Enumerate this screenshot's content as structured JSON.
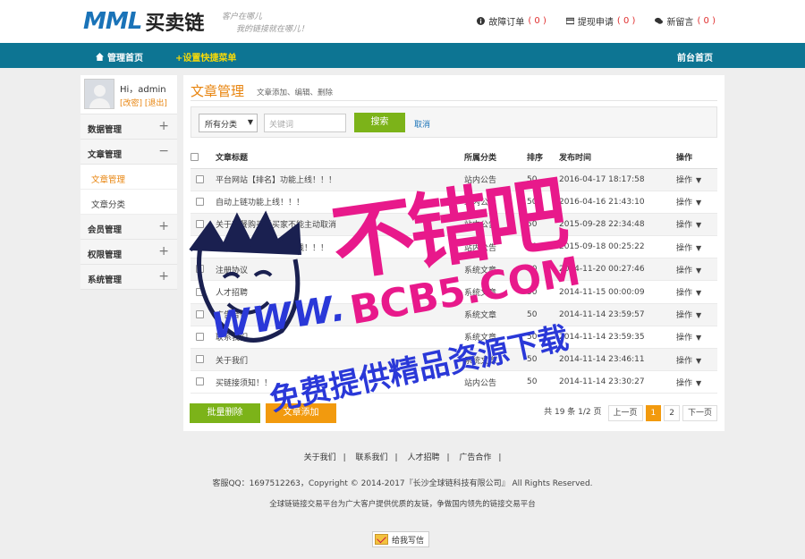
{
  "header": {
    "logo_mark": "MML",
    "logo_cn": "买卖链",
    "slogan_line1": "客户在哪儿",
    "slogan_line2": "我的链接就在哪儿！",
    "links": [
      {
        "label": "故障订单",
        "count": "0",
        "icon": "info-icon"
      },
      {
        "label": "提现申请",
        "count": "0",
        "icon": "card-icon"
      },
      {
        "label": "新留言",
        "count": "0",
        "icon": "chat-icon"
      }
    ]
  },
  "nav": {
    "home": "管理首页",
    "quick_menu": "+设置快捷菜单",
    "front": "前台首页"
  },
  "sidebar": {
    "greeting": "Hi，admin",
    "modify": "[改密]",
    "logout": "[退出]",
    "groups": [
      {
        "label": "数据管理",
        "symbol": "+"
      },
      {
        "label": "文章管理",
        "symbol": "−"
      },
      {
        "label": "会员管理",
        "symbol": "+"
      },
      {
        "label": "权限管理",
        "symbol": "+"
      },
      {
        "label": "系统管理",
        "symbol": "+"
      }
    ],
    "subitems": [
      "文章管理",
      "文章分类"
    ]
  },
  "main": {
    "title": "文章管理",
    "subtitle": "文章添加、编辑、删除",
    "filter": {
      "category_selected": "所有分类",
      "keyword_placeholder": "关键词",
      "search_label": "搜索",
      "cancel_label": "取消"
    },
    "table": {
      "headers": [
        "文章标题",
        "所属分类",
        "排序",
        "发布时间",
        "操作"
      ],
      "rows": [
        {
          "title": "平台网站【排名】功能上线！！！",
          "category": "站内公告",
          "sort": "50",
          "time": "2016-04-17 18:17:58",
          "op": "操作"
        },
        {
          "title": "自动上链功能上线！！！",
          "category": "站内公告",
          "sort": "50",
          "time": "2016-04-16 21:43:10",
          "op": "操作"
        },
        {
          "title": "关于套餐购买后买家不能主动取消",
          "category": "站内公告",
          "sort": "50",
          "time": "2015-09-28 22:34:48",
          "op": "操作"
        },
        {
          "title": "全球链链接套餐正式上线！！！",
          "category": "站内公告",
          "sort": "50",
          "time": "2015-09-18 00:25:22",
          "op": "操作"
        },
        {
          "title": "注册协议",
          "category": "系统文章",
          "sort": "50",
          "time": "2014-11-20 00:27:46",
          "op": "操作"
        },
        {
          "title": "人才招聘",
          "category": "系统文章",
          "sort": "50",
          "time": "2014-11-15 00:00:09",
          "op": "操作"
        },
        {
          "title": "广告合作",
          "category": "系统文章",
          "sort": "50",
          "time": "2014-11-14 23:59:57",
          "op": "操作"
        },
        {
          "title": "联系我们",
          "category": "系统文章",
          "sort": "50",
          "time": "2014-11-14 23:59:35",
          "op": "操作"
        },
        {
          "title": "关于我们",
          "category": "系统文章",
          "sort": "50",
          "time": "2014-11-14 23:46:11",
          "op": "操作"
        },
        {
          "title": "买链接须知！！",
          "category": "站内公告",
          "sort": "50",
          "time": "2014-11-14 23:30:27",
          "op": "操作"
        }
      ]
    },
    "batch_delete": "批量删除",
    "add_article": "文章添加",
    "pager": {
      "info": "共 19 条 1/2 页",
      "prev": "上一页",
      "pages": [
        "1",
        "2"
      ],
      "current": "1",
      "next": "下一页"
    }
  },
  "footer": {
    "links": [
      "关于我们",
      "联系我们",
      "人才招聘",
      "广告合作"
    ],
    "separator": "|",
    "copyright": "客服QQ：1697512263，Copyright © 2014-2017『长沙全球链科技有限公司』 All Rights Reserved.",
    "desc": "全球链链接交易平台为广大客户提供优质的友链，争做国内领先的链接交易平台",
    "mail_button": "给我写信"
  },
  "watermark": {
    "title": "不错吧",
    "domain": "BCB5.COM",
    "url": "WWW.",
    "slogan": "免费提供精品资源下载"
  },
  "colors": {
    "nav_bg": "#0d7593",
    "accent_orange": "#e8840e",
    "green_button": "#7cb319",
    "orange_button": "#f29a0e",
    "count_red": "#e03030"
  }
}
